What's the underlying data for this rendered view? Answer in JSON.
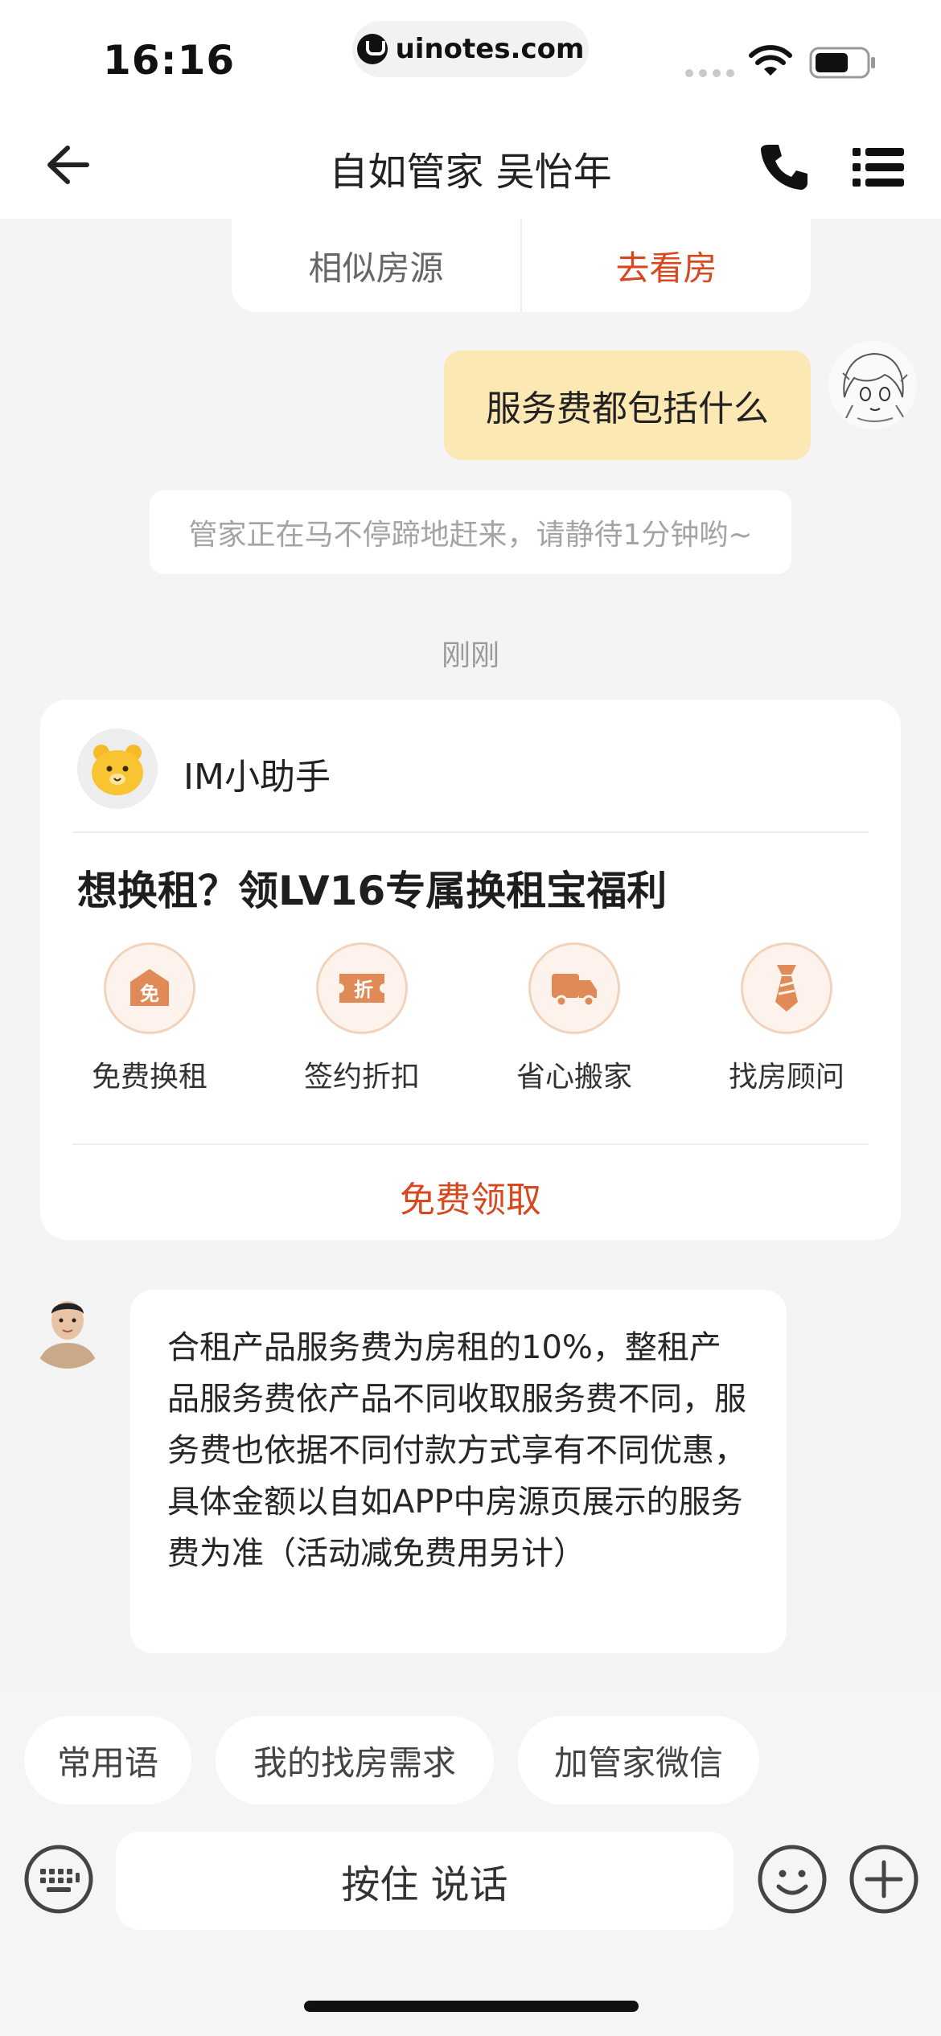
{
  "status_bar": {
    "time": "16:16",
    "url": "uinotes.com"
  },
  "nav": {
    "title": "自如管家 吴怡年"
  },
  "property_actions": {
    "similar": "相似房源",
    "visit": "去看房"
  },
  "messages": {
    "user_text": "服务费都包括什么",
    "system_notice": "管家正在马不停蹄地赶来，请静待1分钟哟~",
    "timestamp": "刚刚",
    "assistant": {
      "name": "IM小助手",
      "title": "想换租？领LV16专属换租宝福利",
      "perks": [
        {
          "label": "免费换租",
          "icon": "free-rent-icon",
          "glyph": "免"
        },
        {
          "label": "签约折扣",
          "icon": "discount-ticket-icon",
          "glyph": "折"
        },
        {
          "label": "省心搬家",
          "icon": "moving-truck-icon",
          "glyph": ""
        },
        {
          "label": "找房顾问",
          "icon": "advisor-tie-icon",
          "glyph": ""
        }
      ],
      "claim": "免费领取"
    },
    "agent_text": "合租产品服务费为房租的10%，整租产品服务费依产品不同收取服务费不同，服务费也依据不同付款方式享有不同优惠，具体金额以自如APP中房源页展示的服务费为准（活动减免费用另计）"
  },
  "quick_replies": [
    "常用语",
    "我的找房需求",
    "加管家微信"
  ],
  "input": {
    "voice_label": "按住 说话"
  },
  "colors": {
    "accent": "#d9471f",
    "user_bubble": "#fbe8b3",
    "perk_icon": "#e08a57"
  }
}
